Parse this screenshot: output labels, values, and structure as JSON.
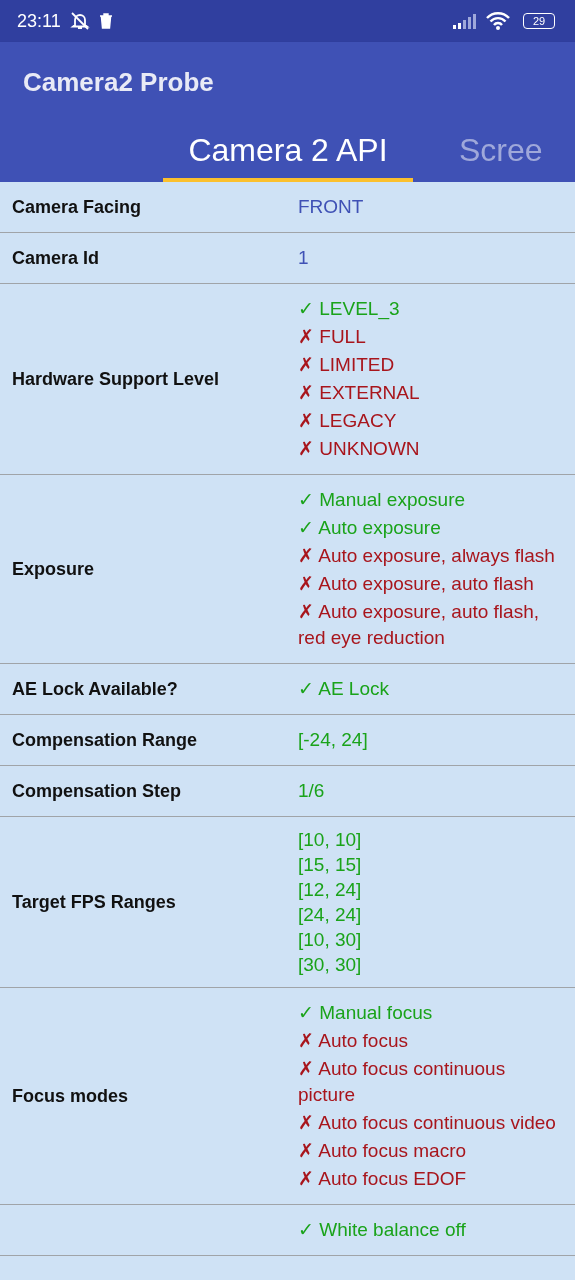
{
  "status_bar": {
    "time": "23:11",
    "battery": "29"
  },
  "app_bar": {
    "title": "Camera2 Probe"
  },
  "tabs": [
    {
      "label": "Camera 2 API",
      "selected": true
    },
    {
      "label": "Scree",
      "selected": false
    }
  ],
  "rows": [
    {
      "label": "Camera Facing",
      "values": [
        {
          "text": "FRONT",
          "kind": "info"
        }
      ]
    },
    {
      "label": "Camera Id",
      "values": [
        {
          "text": "1",
          "kind": "info"
        }
      ]
    },
    {
      "label": "Hardware Support Level",
      "values": [
        {
          "text": "✓ LEVEL_3",
          "kind": "yes"
        },
        {
          "text": "✗ FULL",
          "kind": "no"
        },
        {
          "text": "✗ LIMITED",
          "kind": "no"
        },
        {
          "text": "✗ EXTERNAL",
          "kind": "no"
        },
        {
          "text": "✗ LEGACY",
          "kind": "no"
        },
        {
          "text": "✗ UNKNOWN",
          "kind": "no"
        }
      ]
    },
    {
      "label": "Exposure",
      "values": [
        {
          "text": "✓ Manual exposure",
          "kind": "yes"
        },
        {
          "text": "✓ Auto exposure",
          "kind": "yes"
        },
        {
          "text": "✗ Auto exposure, always flash",
          "kind": "no"
        },
        {
          "text": "✗ Auto exposure, auto flash",
          "kind": "no"
        },
        {
          "text": "✗ Auto exposure, auto flash, red eye reduction",
          "kind": "no"
        }
      ]
    },
    {
      "label": "AE Lock Available?",
      "values": [
        {
          "text": "✓ AE Lock",
          "kind": "yes"
        }
      ]
    },
    {
      "label": "Compensation Range",
      "values": [
        {
          "text": "[-24, 24]",
          "kind": "value"
        }
      ]
    },
    {
      "label": "Compensation Step",
      "values": [
        {
          "text": "1/6",
          "kind": "value"
        }
      ]
    },
    {
      "label": "Target FPS Ranges",
      "values": [
        {
          "text": "[10, 10]",
          "kind": "range"
        },
        {
          "text": "[15, 15]",
          "kind": "range"
        },
        {
          "text": "[12, 24]",
          "kind": "range"
        },
        {
          "text": "[24, 24]",
          "kind": "range"
        },
        {
          "text": "[10, 30]",
          "kind": "range"
        },
        {
          "text": "[30, 30]",
          "kind": "range"
        }
      ]
    },
    {
      "label": "Focus modes",
      "values": [
        {
          "text": "✓ Manual focus",
          "kind": "yes"
        },
        {
          "text": "✗ Auto focus",
          "kind": "no"
        },
        {
          "text": "✗ Auto focus continuous picture",
          "kind": "no"
        },
        {
          "text": "✗ Auto focus continuous video",
          "kind": "no"
        },
        {
          "text": "✗ Auto focus macro",
          "kind": "no"
        },
        {
          "text": "✗ Auto focus EDOF",
          "kind": "no"
        }
      ]
    },
    {
      "values": [
        {
          "text": "✓ White balance off",
          "kind": "yes"
        }
      ]
    }
  ]
}
